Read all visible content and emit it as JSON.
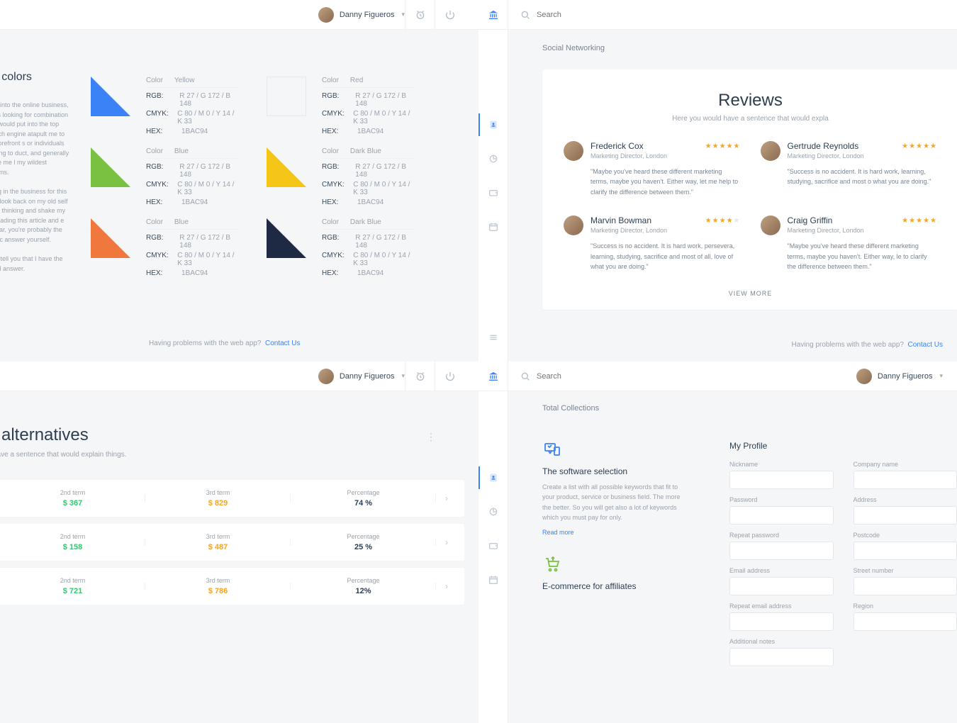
{
  "topbar": {
    "username": "Danny Figueros",
    "search_placeholder": "Search"
  },
  "footer": {
    "prompt": "Having problems with the web app?",
    "contact": "Contact Us"
  },
  "panel1": {
    "title": "ng colors",
    "body_a": "t got into the online business, I was looking for combination that would put into the top search engine atapult me to the forefront s or individuals looking to duct, and generally make me l my wildest dreams.",
    "body_b": "eding in the business for this le to look back on my old self nd of thinking and shake my 're reading this article and e this far, you're probably the magic answer yourself.",
    "body_c": "re to tell you that I have the nd all answer.",
    "colors": [
      {
        "tri": "#3b82f6",
        "name": "Yellow",
        "rgb": "R 27 / G 172 / B 148",
        "cmyk": "C 80 / M 0 / Y 14 / K 33",
        "hex": "1BAC94"
      },
      {
        "tri": "none",
        "name": "Red",
        "rgb": "R 27 / G 172 / B 148",
        "cmyk": "C 80 / M 0 / Y 14 / K 33",
        "hex": "1BAC94"
      },
      {
        "tri": "#7ac142",
        "name": "Blue",
        "rgb": "R 27 / G 172 / B 148",
        "cmyk": "C 80 / M 0 / Y 14 / K 33",
        "hex": "1BAC94"
      },
      {
        "tri": "#f5c518",
        "name": "Dark Blue",
        "rgb": "R 27 / G 172 / B 148",
        "cmyk": "C 80 / M 0 / Y 14 / K 33",
        "hex": "1BAC94"
      },
      {
        "tri": "#f0783c",
        "name": "Blue",
        "rgb": "R 27 / G 172 / B 148",
        "cmyk": "C 80 / M 0 / Y 14 / K 33",
        "hex": "1BAC94"
      },
      {
        "tri": "#1e2a44",
        "name": "Dark Blue",
        "rgb": "R 27 / G 172 / B 148",
        "cmyk": "C 80 / M 0 / Y 14 / K 33",
        "hex": "1BAC94"
      }
    ],
    "labels": {
      "color": "Color",
      "rgb": "RGB:",
      "cmyk": "CMYK:",
      "hex": "HEX:"
    }
  },
  "panel2": {
    "crumb": "Social Networking",
    "title": "Reviews",
    "sub": "Here you would have a sentence that would expla",
    "view_more": "VIEW MORE",
    "reviews": [
      {
        "name": "Frederick Cox",
        "role": "Marketing Director, London",
        "stars": 5,
        "quote": "\"Maybe you've heard these different marketing terms, maybe you haven't. Either way, let me help to clarify the difference between them.\""
      },
      {
        "name": "Gertrude Reynolds",
        "role": "Marketing Director, London",
        "stars": 5,
        "quote": "\"Success is no accident. It is hard work, learning, studying, sacrifice and most o what you are doing.\""
      },
      {
        "name": "Marvin Bowman",
        "role": "Marketing Director, London",
        "stars": 4,
        "quote": "\"Success is no accident. It is hard work, persevera, learning, studying, sacrifice and most of all, love of what you are doing.\""
      },
      {
        "name": "Craig Griffin",
        "role": "Marketing Director, London",
        "stars": 5,
        "quote": "\"Maybe you've heard these different marketing terms, maybe you haven't. Either way, le to clarify the difference between them.\""
      }
    ]
  },
  "panel3": {
    "title": "l alternatives",
    "sub": "have a sentence that would explain things.",
    "headers": {
      "c1": "2nd term",
      "c2": "3rd term",
      "c3": "Percentage"
    },
    "rows": [
      {
        "c1": "$ 367",
        "c2": "$ 829",
        "c3": "74 %"
      },
      {
        "c1": "$ 158",
        "c2": "$ 487",
        "c3": "25 %"
      },
      {
        "c1": "$ 721",
        "c2": "$ 786",
        "c3": "12%"
      }
    ]
  },
  "panel4": {
    "crumb": "Total Collections",
    "features": [
      {
        "title": "The software selection",
        "desc": "Create a list with all possible keywords that fit to your product, service or business field. The more the better. So you will get also a lot of keywords which you must pay for only.",
        "link": "Read more",
        "icon": "devices"
      },
      {
        "title": "E-commerce for affiliates",
        "desc": "",
        "link": "",
        "icon": "cart"
      }
    ],
    "form": {
      "title": "My Profile",
      "left": [
        "Nickname",
        "Password",
        "Repeat password",
        "Email address",
        "Repeat email address",
        "Additional notes"
      ],
      "right": [
        "Company name",
        "Address",
        "Postcode",
        "Street number",
        "Region"
      ]
    }
  }
}
